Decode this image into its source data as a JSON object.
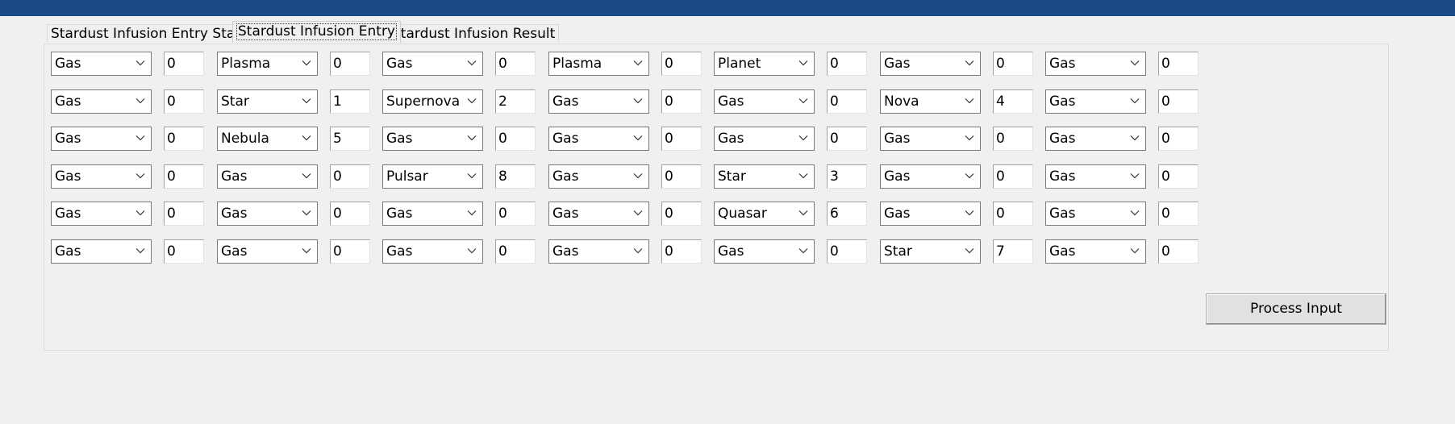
{
  "tabs": [
    {
      "label": "Stardust Infusion Entry Start",
      "active": false
    },
    {
      "label": "Stardust Infusion Entry",
      "active": true
    },
    {
      "label": "Stardust Infusion Result",
      "active": false
    }
  ],
  "grid": {
    "rows": [
      {
        "cells": [
          {
            "type": "Gas",
            "amount": "0"
          },
          {
            "type": "Plasma",
            "amount": "0"
          },
          {
            "type": "Gas",
            "amount": "0"
          },
          {
            "type": "Plasma",
            "amount": "0"
          },
          {
            "type": "Planet",
            "amount": "0"
          },
          {
            "type": "Gas",
            "amount": "0"
          },
          {
            "type": "Gas",
            "amount": "0"
          }
        ]
      },
      {
        "cells": [
          {
            "type": "Gas",
            "amount": "0"
          },
          {
            "type": "Star",
            "amount": "1"
          },
          {
            "type": "Supernova",
            "amount": "2"
          },
          {
            "type": "Gas",
            "amount": "0"
          },
          {
            "type": "Gas",
            "amount": "0"
          },
          {
            "type": "Nova",
            "amount": "4"
          },
          {
            "type": "Gas",
            "amount": "0"
          }
        ]
      },
      {
        "cells": [
          {
            "type": "Gas",
            "amount": "0"
          },
          {
            "type": "Nebula",
            "amount": "5"
          },
          {
            "type": "Gas",
            "amount": "0"
          },
          {
            "type": "Gas",
            "amount": "0"
          },
          {
            "type": "Gas",
            "amount": "0"
          },
          {
            "type": "Gas",
            "amount": "0"
          },
          {
            "type": "Gas",
            "amount": "0"
          }
        ]
      },
      {
        "cells": [
          {
            "type": "Gas",
            "amount": "0"
          },
          {
            "type": "Gas",
            "amount": "0"
          },
          {
            "type": "Pulsar",
            "amount": "8"
          },
          {
            "type": "Gas",
            "amount": "0"
          },
          {
            "type": "Star",
            "amount": "3"
          },
          {
            "type": "Gas",
            "amount": "0"
          },
          {
            "type": "Gas",
            "amount": "0"
          }
        ]
      },
      {
        "cells": [
          {
            "type": "Gas",
            "amount": "0"
          },
          {
            "type": "Gas",
            "amount": "0"
          },
          {
            "type": "Gas",
            "amount": "0"
          },
          {
            "type": "Gas",
            "amount": "0"
          },
          {
            "type": "Quasar",
            "amount": "6"
          },
          {
            "type": "Gas",
            "amount": "0"
          },
          {
            "type": "Gas",
            "amount": "0"
          }
        ]
      },
      {
        "cells": [
          {
            "type": "Gas",
            "amount": "0"
          },
          {
            "type": "Gas",
            "amount": "0"
          },
          {
            "type": "Gas",
            "amount": "0"
          },
          {
            "type": "Gas",
            "amount": "0"
          },
          {
            "type": "Gas",
            "amount": "0"
          },
          {
            "type": "Star",
            "amount": "7"
          },
          {
            "type": "Gas",
            "amount": "0"
          }
        ]
      }
    ]
  },
  "actions": {
    "process_label": "Process Input"
  },
  "colors": {
    "titlebar": "#1b4a87",
    "background": "#f0f0f0",
    "input_background": "#ffffff",
    "button_face": "#e1e1e1"
  },
  "icons": {
    "dropdown": "chevron-down-icon"
  }
}
